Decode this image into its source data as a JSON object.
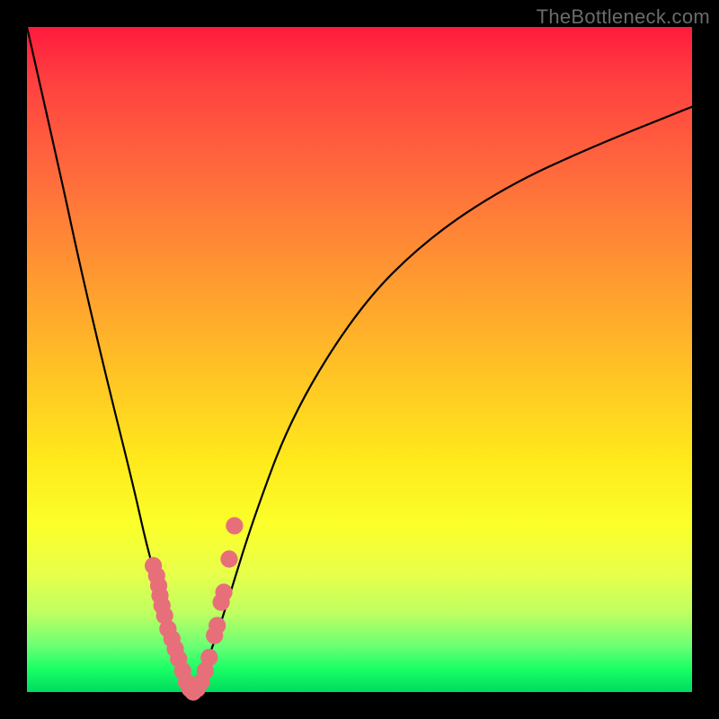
{
  "watermark": "TheBottleneck.com",
  "chart_data": {
    "type": "line",
    "title": "",
    "xlabel": "",
    "ylabel": "",
    "xlim": [
      0,
      100
    ],
    "ylim": [
      0,
      100
    ],
    "grid": false,
    "annotations": [
      "V-shaped bottleneck curve with minimum near x≈25; two branches rise toward edges"
    ],
    "series": [
      {
        "name": "left-branch",
        "x": [
          0,
          5,
          8,
          12,
          16,
          18,
          20,
          22.5,
          24,
          25
        ],
        "y": [
          100,
          78,
          64,
          47,
          31,
          22,
          15,
          8,
          3,
          0
        ]
      },
      {
        "name": "right-branch",
        "x": [
          25,
          26,
          28,
          30,
          34,
          40,
          50,
          60,
          72,
          85,
          100
        ],
        "y": [
          0,
          2,
          7,
          13,
          26,
          42,
          58,
          68,
          76,
          82,
          88
        ]
      }
    ],
    "markers": {
      "name": "beads",
      "color": "#e76f7a",
      "points_x": [
        19,
        19.5,
        19.8,
        20,
        20.3,
        20.7,
        21.2,
        21.8,
        22.3,
        22.8,
        23.4,
        24,
        24.5,
        25,
        25.6,
        26.2,
        26.8,
        27.4,
        28.2,
        28.6,
        29.2,
        29.6,
        30.4,
        31.2
      ],
      "points_y": [
        19,
        17.5,
        16,
        14.5,
        13,
        11.5,
        9.5,
        8,
        6.5,
        5,
        3.2,
        1.5,
        0.5,
        0,
        0.5,
        1.5,
        3.2,
        5.2,
        8.5,
        10,
        13.5,
        15,
        20,
        25
      ],
      "radius": 1.3
    },
    "gradient_stops": [
      {
        "pos": 0,
        "color": "#ff1a3d"
      },
      {
        "pos": 65,
        "color": "#ffe91c"
      },
      {
        "pos": 100,
        "color": "#00db5e"
      }
    ]
  }
}
